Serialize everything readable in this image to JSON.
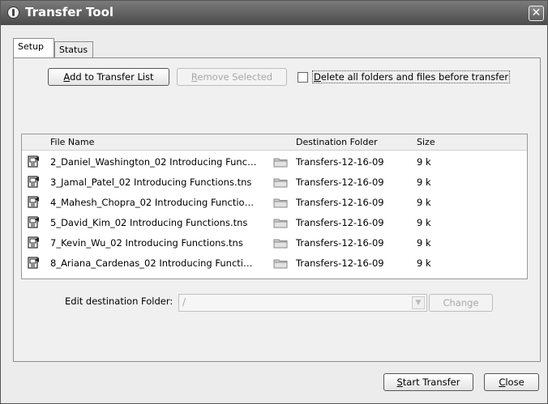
{
  "window": {
    "title": "Transfer Tool",
    "close_glyph": "✕"
  },
  "tabs": [
    {
      "label": "Setup",
      "active": true
    },
    {
      "label": "Status",
      "active": false
    }
  ],
  "toolbar": {
    "add_label_u": "A",
    "add_label_rest": "dd to Transfer List",
    "remove_label_u": "R",
    "remove_label_rest": "emove Selected",
    "remove_enabled": false,
    "delete_checkbox_u": "D",
    "delete_checkbox_rest": "elete all folders and files before transfer",
    "delete_checked": false
  },
  "table": {
    "columns": [
      "File Name",
      "Destination Folder",
      "Size"
    ],
    "rows": [
      {
        "file": "2_Daniel_Washington_02 Introducing Func…",
        "dest": "Transfers-12-16-09",
        "size": "9 k"
      },
      {
        "file": "3_Jamal_Patel_02 Introducing Functions.tns",
        "dest": "Transfers-12-16-09",
        "size": "9 k"
      },
      {
        "file": "4_Mahesh_Chopra_02 Introducing Functio…",
        "dest": "Transfers-12-16-09",
        "size": "9 k"
      },
      {
        "file": "5_David_Kim_02 Introducing Functions.tns",
        "dest": "Transfers-12-16-09",
        "size": "9 k"
      },
      {
        "file": "7_Kevin_Wu_02 Introducing Functions.tns",
        "dest": "Transfers-12-16-09",
        "size": "9 k"
      },
      {
        "file": "8_Ariana_Cardenas_02 Introducing Functi…",
        "dest": "Transfers-12-16-09",
        "size": "9 k"
      }
    ]
  },
  "destination": {
    "label": "Edit destination Folder:",
    "value": "/",
    "change_label": "Change",
    "change_enabled": false
  },
  "footer": {
    "start_label_u": "S",
    "start_label_rest": "tart Transfer",
    "close_label_u": "C",
    "close_label_rest": "lose"
  },
  "icons": {
    "title": "app-icon",
    "file": "tns-document-icon",
    "folder": "folder-icon"
  }
}
